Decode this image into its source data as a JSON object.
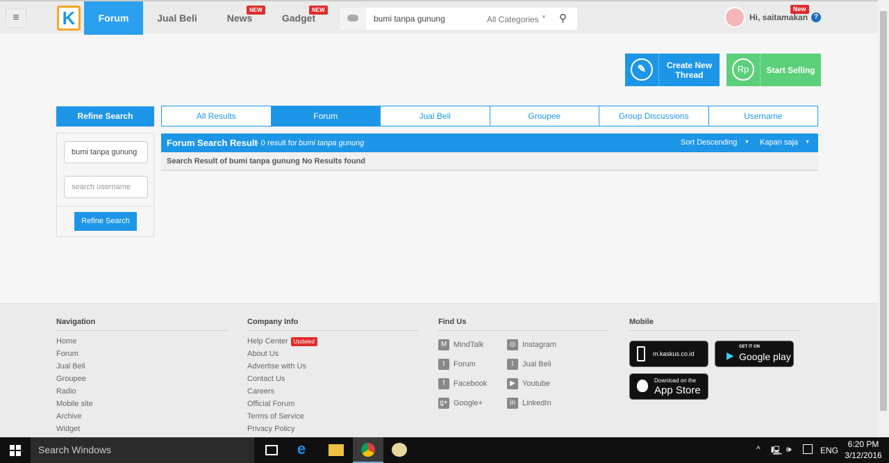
{
  "header": {
    "nav": [
      "Forum",
      "Jual Beli",
      "News",
      "Gadget"
    ],
    "new_badge": "NEW",
    "search_value": "bumi tanpa gunung",
    "category": "All Categories",
    "greeting": "Hi, saitamakan",
    "user_new": "New",
    "help": "?"
  },
  "actions": {
    "create": "Create New Thread",
    "sell": "Start Selling",
    "rp": "Rp"
  },
  "tabs": [
    "All Results",
    "Forum",
    "Jual Beli",
    "Groupee",
    "Group Discussions",
    "Username"
  ],
  "refine": {
    "title": "Refine Search",
    "keyword": "bumi tanpa gunung",
    "username_placeholder": "search username",
    "button": "Refine Search"
  },
  "result": {
    "title": "Forum Search Result",
    "count": " - 0 result for ",
    "query": "bumi tanpa gunung",
    "sort": "Sort Descending",
    "time": "Kapan saja",
    "message": "Search Result of bumi tanpa gunung No Results found"
  },
  "footer": {
    "navigation": {
      "title": "Navigation",
      "items": [
        "Home",
        "Forum",
        "Jual Beli",
        "Groupee",
        "Radio",
        "Mobile site",
        "Archive",
        "Widget"
      ]
    },
    "company": {
      "title": "Company Info",
      "items": [
        "Help Center",
        "About Us",
        "Advertise with Us",
        "Contact Us",
        "Careers",
        "Official Forum",
        "Terms of Service",
        "Privacy Policy"
      ],
      "updated": "Updated"
    },
    "findus": {
      "title": "Find Us",
      "items": [
        "MindTalk",
        "Instagram",
        "Forum",
        "Jual Beli",
        "Facebook",
        "Youtube",
        "Google+",
        "LinkedIn"
      ]
    },
    "mobile": {
      "title": "Mobile",
      "site": "m.kaskus.co.id",
      "gp_small": "GET IT ON",
      "gp": "Google play",
      "as_small": "Download on the",
      "as": "App Store"
    }
  },
  "taskbar": {
    "search": "Search Windows",
    "lang": "ENG",
    "time": "6:20 PM",
    "date": "3/12/2016"
  }
}
